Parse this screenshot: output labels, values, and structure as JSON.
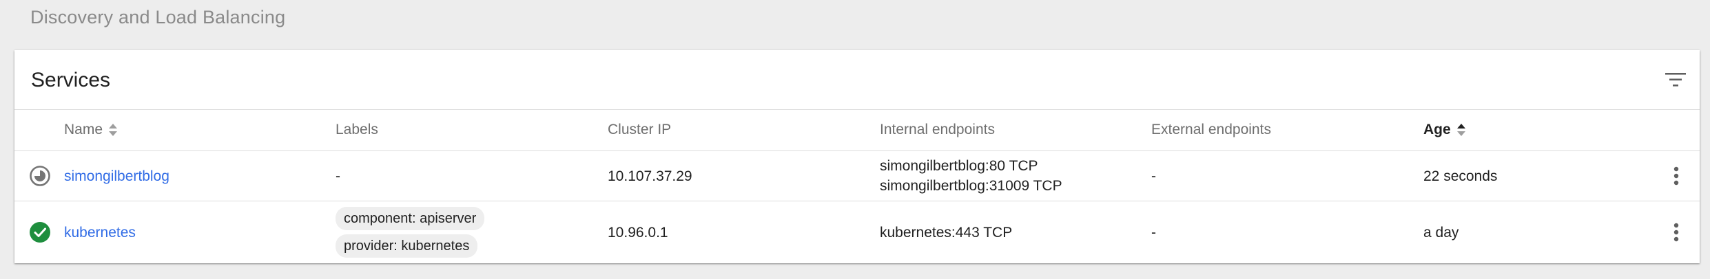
{
  "page": {
    "section_title": "Discovery and Load Balancing"
  },
  "services": {
    "title": "Services",
    "filter_icon": "filter-list-icon",
    "columns": {
      "name": "Name",
      "labels": "Labels",
      "cluster_ip": "Cluster IP",
      "internal_endpoints": "Internal endpoints",
      "external_endpoints": "External endpoints",
      "age": "Age"
    },
    "sorted_column": "Age",
    "rows": [
      {
        "status": "pending",
        "status_icon": "pending-clock-icon",
        "name": "simongilbertblog",
        "labels": "-",
        "cluster_ip": "10.107.37.29",
        "internal_endpoints": [
          "simongilbertblog:80 TCP",
          "simongilbertblog:31009 TCP"
        ],
        "external_endpoints": "-",
        "age": "22 seconds"
      },
      {
        "status": "success",
        "status_icon": "check-circle-icon",
        "name": "kubernetes",
        "labels": [
          "component: apiserver",
          "provider: kubernetes"
        ],
        "cluster_ip": "10.96.0.1",
        "internal_endpoints": [
          "kubernetes:443 TCP"
        ],
        "external_endpoints": "-",
        "age": "a day"
      }
    ]
  },
  "colors": {
    "link": "#326de6",
    "success": "#1e8e3e",
    "pending": "#757575"
  }
}
